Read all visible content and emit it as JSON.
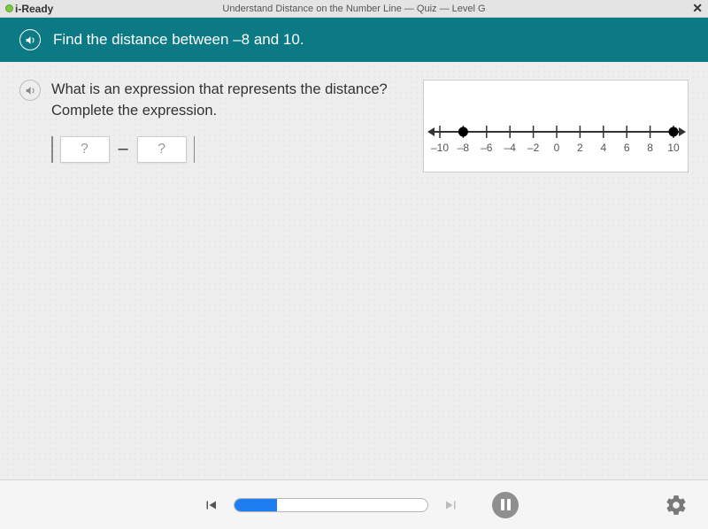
{
  "title_bar": {
    "brand": "i-Ready",
    "title": "Understand Distance on the Number Line — Quiz — Level G",
    "close": "✕"
  },
  "banner": {
    "text": "Find the distance between –8 and 10."
  },
  "question": {
    "text": "What is an expression that represents the distance? Complete the expression.",
    "dropdown1_placeholder": "?",
    "dropdown2_placeholder": "?",
    "minus": "–"
  },
  "number_line": {
    "ticks": [
      "–10",
      "–8",
      "–6",
      "–4",
      "–2",
      "0",
      "2",
      "4",
      "6",
      "8",
      "10"
    ],
    "points": [
      -8,
      10
    ],
    "min": -10,
    "max": 10
  },
  "footer": {
    "progress_percent": 22
  },
  "chart_data": {
    "type": "line",
    "title": "Number line",
    "xlabel": "",
    "ylabel": "",
    "xlim": [
      -10,
      10
    ],
    "tick_labels": [
      "–10",
      "–8",
      "–6",
      "–4",
      "–2",
      "0",
      "2",
      "4",
      "6",
      "8",
      "10"
    ],
    "marked_points": [
      -8,
      10
    ]
  }
}
